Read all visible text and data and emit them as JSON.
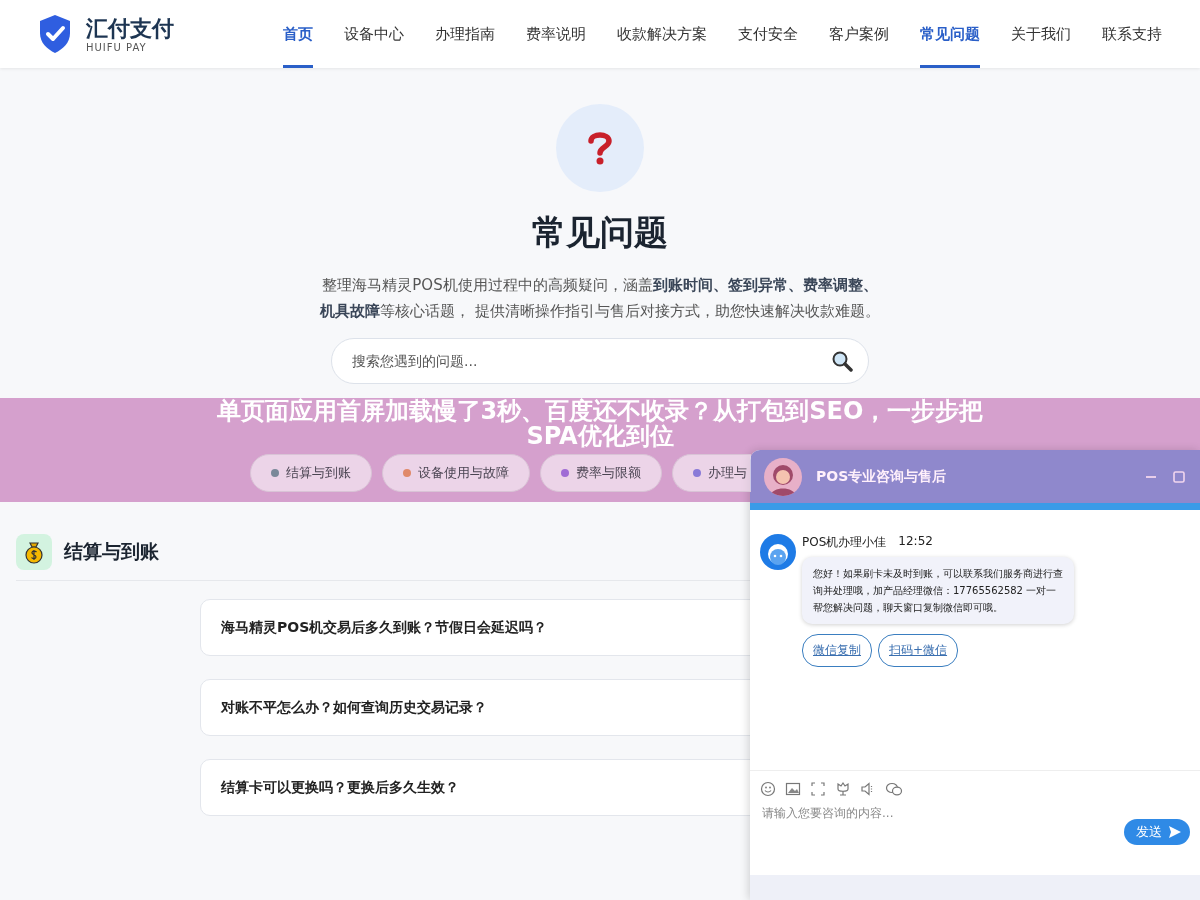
{
  "header": {
    "logo": {
      "name": "汇付支付",
      "subtitle": "HUIFU PAY"
    },
    "nav": [
      {
        "label": "首页",
        "selected": true
      },
      {
        "label": "设备中心",
        "selected": false
      },
      {
        "label": "办理指南",
        "selected": false
      },
      {
        "label": "费率说明",
        "selected": false
      },
      {
        "label": "收款解决方案",
        "selected": false
      },
      {
        "label": "支付安全",
        "selected": false
      },
      {
        "label": "客户案例",
        "selected": false
      },
      {
        "label": "常见问题",
        "selected": true
      },
      {
        "label": "关于我们",
        "selected": false
      },
      {
        "label": "联系支持",
        "selected": false
      }
    ]
  },
  "hero": {
    "title": "常见问题",
    "description": "整理海马精灵POS机使用过程中的高频疑问，涵盖**到账时间、签到异常、费率调整、机具故障**等核心话题， 提供清晰操作指引与售后对接方式，助您快速解决收款难题。",
    "search": {
      "placeholder": "搜索您遇到的问题..."
    }
  },
  "categories": [
    {
      "label": "结算与到账",
      "color": "#7a8899"
    },
    {
      "label": "设备使用与故障",
      "color": "#e0896a"
    },
    {
      "label": "费率与限额",
      "color": "#a06cd5"
    },
    {
      "label": "办理与",
      "color": "#8a7ad8"
    }
  ],
  "sections": [
    {
      "title": "结算与到账",
      "questions": [
        "海马精灵POS机交易后多久到账？节假日会延迟吗？",
        "对账不平怎么办？如何查询历史交易记录？",
        "结算卡可以更换吗？更换后多久生效？"
      ]
    }
  ],
  "banner": {
    "title": "单页面应用首屏加载慢了3秒、百度还不收录？从打包到SEO，一步步把SPA优化到位"
  },
  "chat": {
    "title": "POS专业咨询与售后",
    "messages": [
      {
        "sender": "POS机办理小佳",
        "time": "12:52",
        "text": "您好！如果刷卡未及时到账，可以联系我们服务商进行查询并处理哦，加产品经理微信：17765562582 一对一帮您解决问题，聊天窗口复制微信即可哦。",
        "actions": [
          "微信复制",
          "扫码+微信"
        ]
      }
    ],
    "input": {
      "placeholder": "请输入您要咨询的内容..."
    },
    "send_button": "发送"
  }
}
